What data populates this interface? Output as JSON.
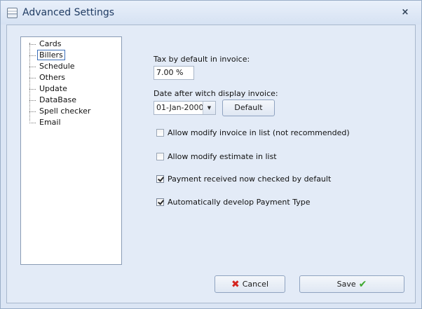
{
  "window": {
    "title": "Advanced Settings",
    "close_label": "×"
  },
  "tree": {
    "items": [
      {
        "label": "Cards",
        "selected": false
      },
      {
        "label": "Billers",
        "selected": true
      },
      {
        "label": "Schedule",
        "selected": false
      },
      {
        "label": "Others",
        "selected": false
      },
      {
        "label": "Update",
        "selected": false
      },
      {
        "label": "DataBase",
        "selected": false
      },
      {
        "label": "Spell checker",
        "selected": false
      },
      {
        "label": "Email",
        "selected": false
      }
    ]
  },
  "form": {
    "tax_label": "Tax by default in invoice:",
    "tax_value": "7.00 %",
    "date_label": "Date after witch display invoice:",
    "date_value": "01-Jan-2000",
    "date_arrow": "▼",
    "default_button": "Default",
    "checkboxes": [
      {
        "label": "Allow modify invoice in list (not recommended)",
        "checked": false
      },
      {
        "label": "Allow modify estimate in list",
        "checked": false
      },
      {
        "label": "Payment received now checked by default",
        "checked": true
      },
      {
        "label": "Automatically develop Payment Type",
        "checked": true
      }
    ]
  },
  "buttons": {
    "cancel_label": "Cancel",
    "cancel_icon": "✖",
    "save_label": "Save",
    "save_icon": "✔"
  },
  "colors": {
    "accent": "#1f3b62",
    "cancel_icon": "#d4241f",
    "save_icon": "#3ea82e"
  }
}
